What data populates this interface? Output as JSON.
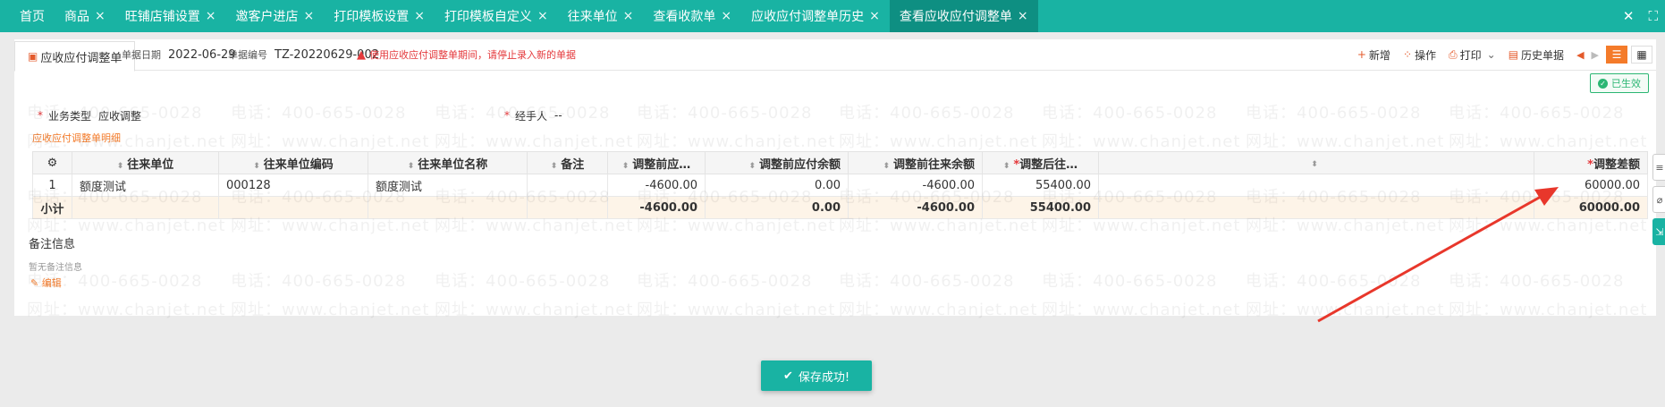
{
  "tabs": [
    {
      "label": "首页",
      "closable": false
    },
    {
      "label": "商品",
      "closable": true
    },
    {
      "label": "旺铺店铺设置",
      "closable": true
    },
    {
      "label": "邀客户进店",
      "closable": true
    },
    {
      "label": "打印模板设置",
      "closable": true
    },
    {
      "label": "打印模板自定义",
      "closable": true
    },
    {
      "label": "往来单位",
      "closable": true
    },
    {
      "label": "查看收款单",
      "closable": true
    },
    {
      "label": "应收应付调整单历史",
      "closable": true
    },
    {
      "label": "查看应收应付调整单",
      "closable": true,
      "active": true
    }
  ],
  "close_glyph": "×",
  "window_controls": {
    "close": "✕",
    "expand": "⛶"
  },
  "doc": {
    "tab_label": "应收应付调整单",
    "date_label": "单据日期",
    "date_value": "2022-06-29",
    "number_label": "单据编号",
    "number_value": "TZ-20220629-002",
    "warning": "使用应收应付调整单期间，请停止录入新的单据"
  },
  "toolbar": {
    "new": "新增",
    "operate": "操作",
    "print": "打印",
    "history": "历史单据"
  },
  "status": "已生效",
  "fields": {
    "business_type_label": "业务类型",
    "business_type_value": "应收调整",
    "handler_label": "经手人",
    "handler_value": "--"
  },
  "detail_title": "应收应付调整单明细",
  "grid": {
    "columns": [
      "往来单位",
      "往来单位编码",
      "往来单位名称",
      "备注",
      "调整前应…",
      "调整前应付余额",
      "调整前往来余额",
      "调整后往…",
      "",
      "调整差额"
    ],
    "rows": [
      {
        "idx": "1",
        "unit": "额度测试",
        "code": "000128",
        "name": "额度测试",
        "remark": "",
        "before_recv": "-4600.00",
        "before_pay": "0.00",
        "before_balance": "-4600.00",
        "after": "55400.00",
        "blank": "",
        "diff": "60000.00"
      }
    ],
    "subtotal": {
      "label": "小计",
      "before_recv": "-4600.00",
      "before_pay": "0.00",
      "before_balance": "-4600.00",
      "after": "55400.00",
      "diff": "60000.00"
    }
  },
  "remarks": {
    "title": "备注信息",
    "empty": "暂无备注信息",
    "edit": "编辑"
  },
  "toast": "保存成功!",
  "watermark": {
    "phone": "电话：400-665-0028",
    "site": "网址：www.chanjet.net"
  },
  "colors": {
    "brand": "#19b3a3",
    "accent": "#f47b2a",
    "danger": "#e4393c",
    "success": "#2bb673"
  }
}
